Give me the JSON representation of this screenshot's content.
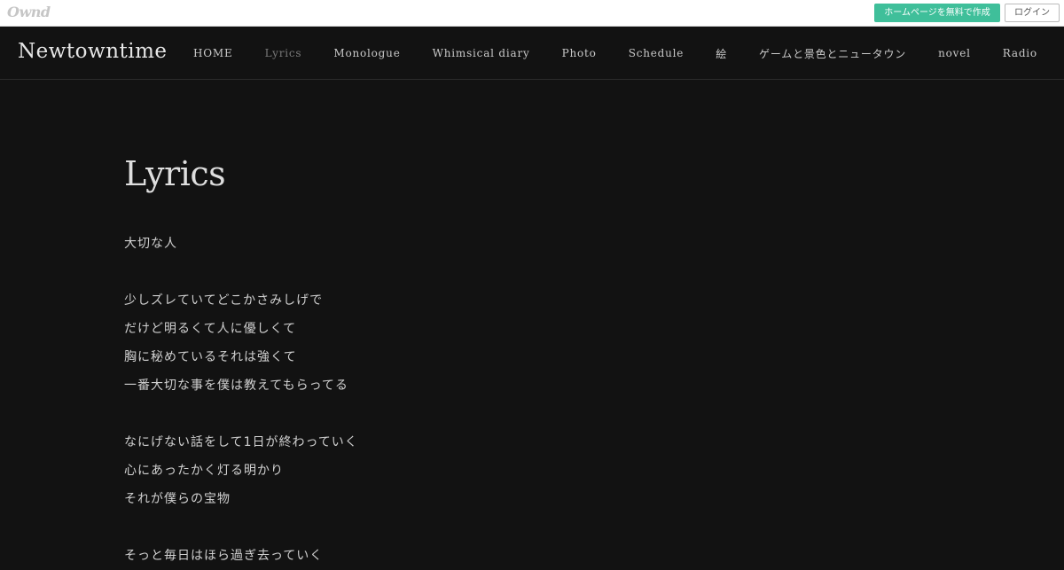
{
  "platform_bar": {
    "logo": "Ownd",
    "create_label": "ホームページを無料で作成",
    "login_label": "ログイン"
  },
  "header": {
    "site_title": "Newtowntime",
    "nav": [
      {
        "label": "HOME"
      },
      {
        "label": "Lyrics",
        "active": true
      },
      {
        "label": "Monologue"
      },
      {
        "label": "Whimsical diary"
      },
      {
        "label": "Photo"
      },
      {
        "label": "Schedule"
      },
      {
        "label": "絵"
      },
      {
        "label": "ゲームと景色とニュータウン"
      },
      {
        "label": "novel"
      },
      {
        "label": "Radio"
      }
    ]
  },
  "main": {
    "title": "Lyrics",
    "lines": [
      "大切な人",
      "",
      "少しズレていてどこかさみしげで",
      "だけど明るくて人に優しくて",
      "胸に秘めているそれは強くて",
      "一番大切な事を僕は教えてもらってる",
      "",
      "なにげない話をして1日が終わっていく",
      "心にあったかく灯る明かり",
      "それが僕らの宝物",
      "",
      "そっと毎日はほら過ぎ去っていく"
    ]
  },
  "colors": {
    "background": "#121212",
    "accent_button": "#3fbf9a",
    "text": "#d0d0d0",
    "nav_active": "#7a7a7a"
  }
}
